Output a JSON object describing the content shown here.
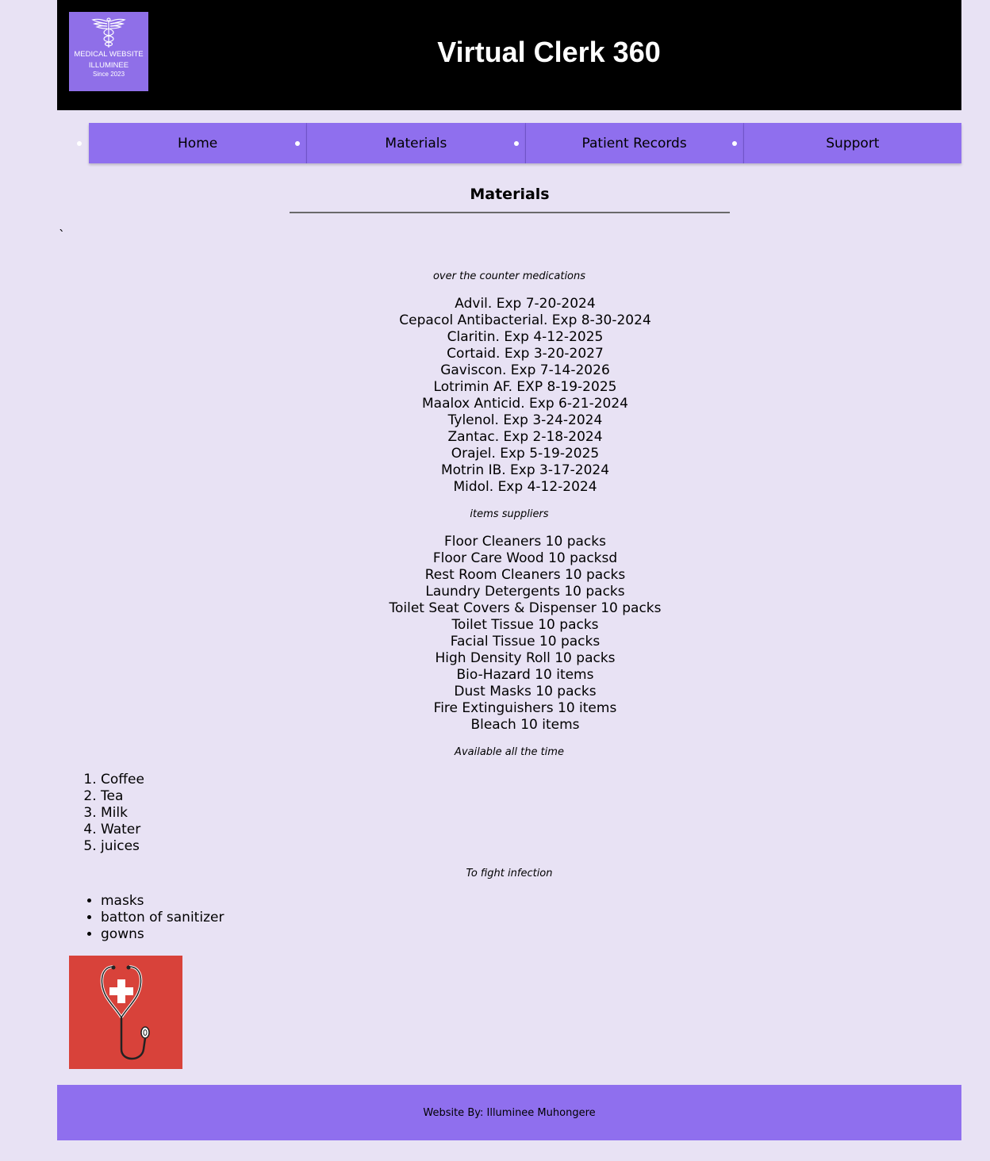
{
  "header": {
    "logo": {
      "line1": "MEDICAL WEBSITE",
      "line2": "ILLUMINEE",
      "line3": "Since 2023"
    },
    "title": "Virtual Clerk 360"
  },
  "nav": {
    "items": [
      {
        "label": "Home"
      },
      {
        "label": "Materials"
      },
      {
        "label": "Patient Records"
      },
      {
        "label": "Support"
      }
    ]
  },
  "main": {
    "heading": "Materials",
    "backtick": "`",
    "sections": [
      {
        "caption": "over the counter medications",
        "items": [
          "Advil. Exp 7-20-2024",
          "Cepacol Antibacterial. Exp 8-30-2024",
          "Claritin. Exp 4-12-2025",
          "Cortaid. Exp 3-20-2027",
          "Gaviscon. Exp 7-14-2026",
          "Lotrimin AF. EXP 8-19-2025",
          "Maalox Anticid. Exp 6-21-2024",
          "Tylenol. Exp 3-24-2024",
          "Zantac. Exp 2-18-2024",
          "Orajel. Exp 5-19-2025",
          "Motrin IB. Exp 3-17-2024",
          "Midol. Exp 4-12-2024"
        ]
      },
      {
        "caption": "items suppliers",
        "items": [
          "Floor Cleaners 10 packs",
          "Floor Care Wood 10 packsd",
          "Rest Room Cleaners 10 packs",
          "Laundry Detergents 10 packs",
          "Toilet Seat Covers & Dispenser 10 packs",
          "Toilet Tissue 10 packs",
          "Facial Tissue 10 packs",
          "High Density Roll 10 packs",
          "Bio-Hazard 10 items",
          "Dust Masks 10 packs",
          "Fire Extinguishers 10 items",
          "Bleach 10 items"
        ]
      },
      {
        "caption": "Available all the time",
        "items": [
          "Coffee",
          "Tea",
          "Milk",
          "Water",
          "juices"
        ]
      },
      {
        "caption": "To fight infection",
        "items": [
          "masks",
          "batton of sanitizer",
          "gowns"
        ]
      }
    ],
    "image": {
      "icon": "stethoscope-heart-cross-icon",
      "background": "#d8423a"
    }
  },
  "footer": {
    "text": "Website By: Illuminee Muhongere"
  },
  "colors": {
    "background": "#e8e2f4",
    "header": "#000000",
    "accent": "#8f6fee"
  }
}
